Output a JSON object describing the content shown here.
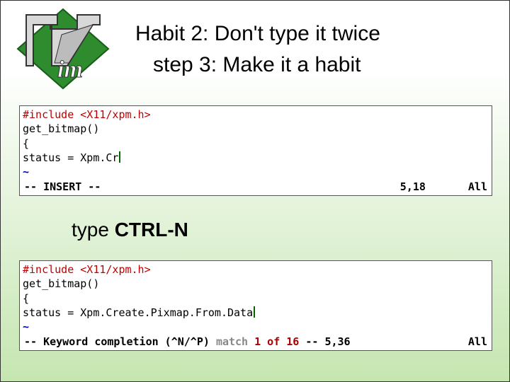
{
  "title": "Habit 2: Don't type it twice",
  "subtitle": "step 3: Make it a habit",
  "caption_prefix": "type ",
  "caption_key": "CTRL-N",
  "editor1": {
    "include": "#include <X11/xpm.h>",
    "blank": "",
    "fn": "get_bitmap()",
    "brace": "{",
    "assign": "status = Xpm.Cr",
    "tilde1": "~",
    "tilde2": "~",
    "status_left": "-- INSERT --",
    "status_mid": "5,18",
    "status_right": "All"
  },
  "editor2": {
    "include": "#include <X11/xpm.h>",
    "blank": "",
    "fn": "get_bitmap()",
    "brace": "{",
    "assign": "status = Xpm.Create.Pixmap.From.Data",
    "tilde1": "~",
    "tilde2": "~",
    "status_left": "-- Keyword completion (^N/^P) ",
    "status_match_grey": "match ",
    "status_match_red": "1 of 16",
    "status_after": " -- 5,36",
    "status_right": "All"
  },
  "logo": {
    "bg_text": "im"
  }
}
